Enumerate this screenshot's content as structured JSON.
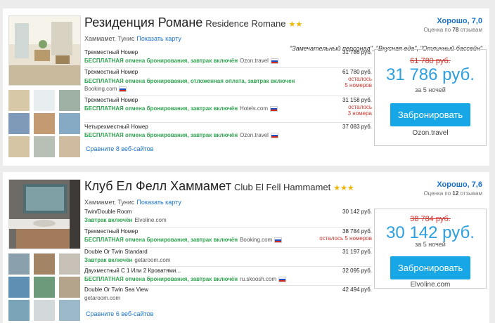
{
  "hotels": [
    {
      "name_ru": "Резиденция Романе",
      "name_en": "Residence Romane",
      "stars": "★★",
      "location": "Хаммамет, Тунис",
      "map_link": "Показать карту",
      "rating_text": "Хорошо, 7,0",
      "reviews_prefix": "Оценка по",
      "reviews_count": "78",
      "reviews_suffix": "отзывам",
      "quote": "\"Замечательный персонал\", \"Вкусная еда\", \"Отличный бассейн\"",
      "offers": [
        {
          "room": "Трехместный Номер",
          "terms": "БЕСПЛАТНАЯ отмена бронирования, завтрак включён",
          "site": "Ozon.travel",
          "price": "31 786 руб.",
          "left": ""
        },
        {
          "room": "Трехместный Номер",
          "terms": "БЕСПЛАТНАЯ отмена бронирования, отложенная оплата, завтрак включен",
          "site": "Booking.com",
          "price": "61 780 руб.",
          "left": "осталось 5 номеров"
        },
        {
          "room": "Трехместный Номер",
          "terms": "БЕСПЛАТНАЯ отмена бронирования, завтрак включён",
          "site": "Hotels.com",
          "price": "31 158 руб.",
          "left": "осталось 3 номера"
        },
        {
          "room": "Четырехместный Номер",
          "terms": "БЕСПЛАТНАЯ отмена бронирования, завтрак включён",
          "site": "Ozon.travel",
          "price": "37 083 руб.",
          "left": ""
        }
      ],
      "compare": "Сравните 8 веб-сайтов",
      "old_price": "61 780 руб.",
      "best_price": "31 786 руб.",
      "nights": "за 5 ночей",
      "book_label": "Забронировать",
      "best_site": "Ozon.travel"
    },
    {
      "name_ru": "Клуб Ел Фелл Хаммамет",
      "name_en": "Club El Fell Hammamet",
      "stars": "★★★",
      "location": "Хаммамет, Тунис",
      "map_link": "Показать карту",
      "rating_text": "Хорошо, 7,6",
      "reviews_prefix": "Оценка по",
      "reviews_count": "12",
      "reviews_suffix": "отзывам",
      "offers": [
        {
          "room": "Twin/Double Room",
          "terms": "Завтрак включён",
          "site": "Elvoline.com",
          "price": "30 142 руб.",
          "left": ""
        },
        {
          "room": "Трехместный Номер",
          "terms": "БЕСПЛАТНАЯ отмена бронирования, завтрак включён",
          "site": "Booking.com",
          "price": "38 784 руб.",
          "left": "осталось 5 номеров"
        },
        {
          "room": "Double Or Twin Standard",
          "terms": "Завтрак включён",
          "site": "getaroom.com",
          "price": "31 197 руб.",
          "left": ""
        },
        {
          "room": "Двухместный С 1 Или 2 Кроватями...",
          "terms": "БЕСПЛАТНАЯ отмена бронирования, завтрак включён",
          "site": "ru.skoosh.com",
          "price": "32 095 руб.",
          "left": ""
        },
        {
          "room": "Double Or Twin Sea View",
          "terms": "",
          "site": "getaroom.com",
          "price": "42 494 руб.",
          "left": ""
        }
      ],
      "compare": "Сравните 6 веб-сайтов",
      "old_price": "38 784 руб.",
      "best_price": "30 142 руб.",
      "nights": "за 5 ночей",
      "book_label": "Забронировать",
      "best_site": "Elvoline.com"
    }
  ]
}
